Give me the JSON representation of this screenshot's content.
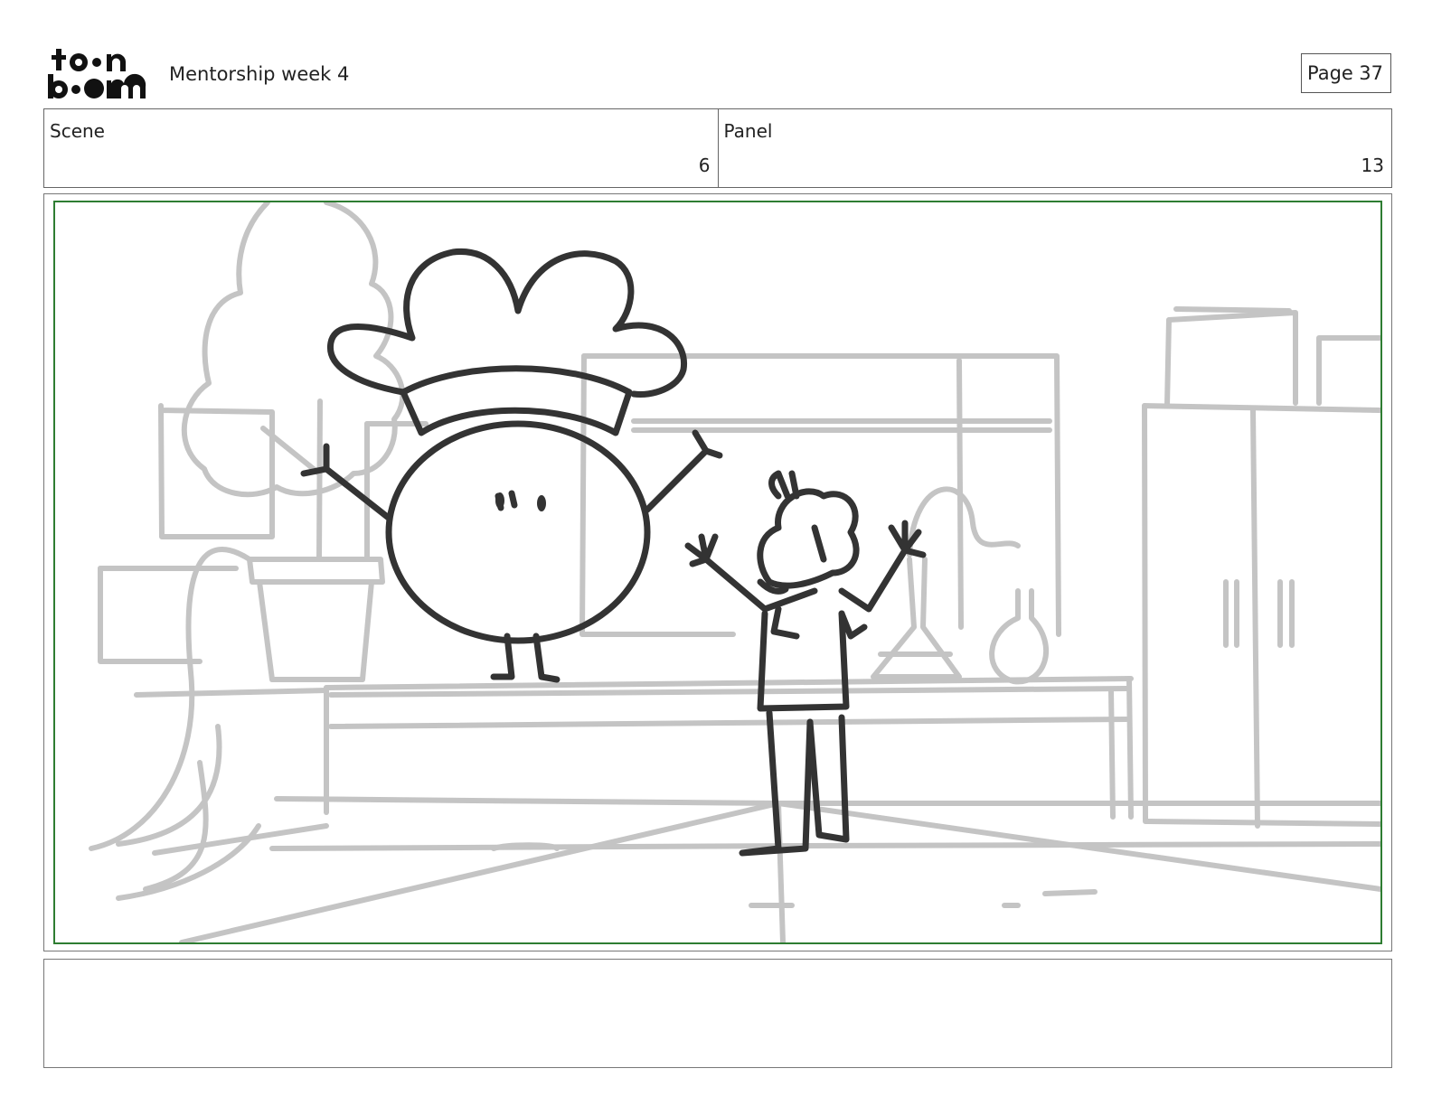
{
  "header": {
    "logo": {
      "icon": "toonboom-logo-icon",
      "text": "toon boom"
    },
    "title": "Mentorship week 4",
    "page_label": "Page",
    "page_number": "37"
  },
  "info": {
    "scene_label": "Scene",
    "scene_value": "6",
    "panel_label": "Panel",
    "panel_value": "13"
  },
  "panel": {
    "frame_color": "#2e7d32",
    "sketch_line_color": "#333333",
    "background_line_color": "#c4c4c4"
  },
  "notes": {
    "text": ""
  }
}
